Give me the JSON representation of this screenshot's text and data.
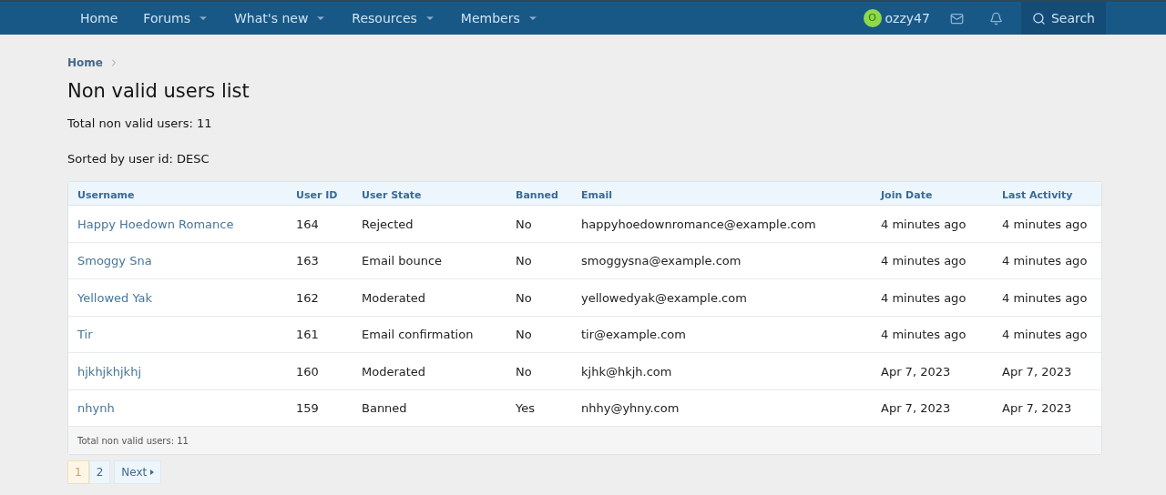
{
  "nav": {
    "items": [
      {
        "label": "Home",
        "dropdown": false
      },
      {
        "label": "Forums",
        "dropdown": true
      },
      {
        "label": "What's new",
        "dropdown": true
      },
      {
        "label": "Resources",
        "dropdown": true
      },
      {
        "label": "Members",
        "dropdown": true
      }
    ],
    "user": {
      "avatar_letter": "O",
      "name": "ozzy47"
    },
    "search": "Search"
  },
  "breadcrumb": [
    "Home"
  ],
  "title": "Non valid users list",
  "summary": [
    "Total non valid users: 11",
    "Sorted by user id: DESC"
  ],
  "table": {
    "columns": [
      "Username",
      "User ID",
      "User State",
      "Banned",
      "Email",
      "Join Date",
      "Last Activity"
    ],
    "rows": [
      [
        "Happy Hoedown Romance",
        "164",
        "Rejected",
        "No",
        "happyhoedownromance@example.com",
        "4 minutes ago",
        "4 minutes ago"
      ],
      [
        "Smoggy Sna",
        "163",
        "Email bounce",
        "No",
        "smoggysna@example.com",
        "4 minutes ago",
        "4 minutes ago"
      ],
      [
        "Yellowed Yak",
        "162",
        "Moderated",
        "No",
        "yellowedyak@example.com",
        "4 minutes ago",
        "4 minutes ago"
      ],
      [
        "Tir",
        "161",
        "Email confirmation",
        "No",
        "tir@example.com",
        "4 minutes ago",
        "4 minutes ago"
      ],
      [
        "hjkhjkhjkhj",
        "160",
        "Moderated",
        "No",
        "kjhk@hkjh.com",
        "Apr 7, 2023",
        "Apr 7, 2023"
      ],
      [
        "nhynh",
        "159",
        "Banned",
        "Yes",
        "nhhy@yhny.com",
        "Apr 7, 2023",
        "Apr 7, 2023"
      ]
    ],
    "footer": "Total non valid users: 11"
  },
  "pagination": {
    "pages": [
      {
        "label": "1",
        "selected": true
      },
      {
        "label": "2",
        "selected": false
      }
    ],
    "next": "Next"
  }
}
